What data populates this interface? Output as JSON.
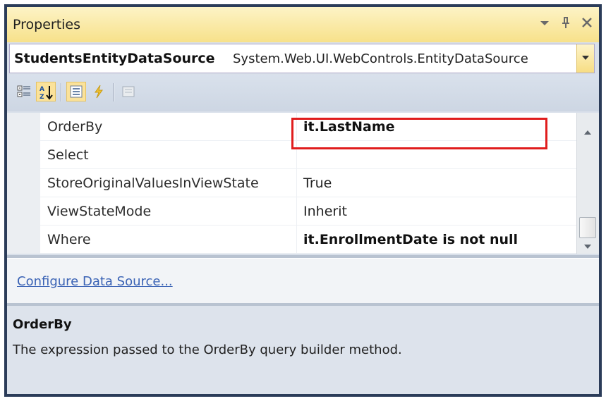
{
  "window": {
    "title": "Properties",
    "controls": [
      "dropdown-arrow",
      "pin",
      "close"
    ]
  },
  "object_selector": {
    "name": "StudentsEntityDataSource",
    "type": "System.Web.UI.WebControls.EntityDataSource"
  },
  "toolbar": {
    "buttons": [
      {
        "name": "categorized-icon",
        "active": false
      },
      {
        "name": "alphabetical-sort-icon",
        "active": true
      },
      {
        "name": "properties-icon",
        "active": true
      },
      {
        "name": "events-lightning-icon",
        "active": false
      },
      {
        "name": "property-pages-icon",
        "active": false
      }
    ]
  },
  "properties": [
    {
      "name": "OrderBy",
      "value": "it.LastName",
      "bold": true,
      "highlighted": true
    },
    {
      "name": "Select",
      "value": "",
      "bold": false
    },
    {
      "name": "StoreOriginalValuesInViewState",
      "value": "True",
      "bold": false
    },
    {
      "name": "ViewStateMode",
      "value": "Inherit",
      "bold": false
    },
    {
      "name": "Where",
      "value": "it.EnrollmentDate is not null",
      "bold": true
    }
  ],
  "commands": {
    "link": "Configure Data Source..."
  },
  "description": {
    "title": "OrderBy",
    "text": "The expression passed to the OrderBy query builder method."
  },
  "colors": {
    "highlight_border": "#e01d1d",
    "title_bar": "#f7e18a",
    "frame": "#2b3c59",
    "link": "#3b63b5"
  }
}
